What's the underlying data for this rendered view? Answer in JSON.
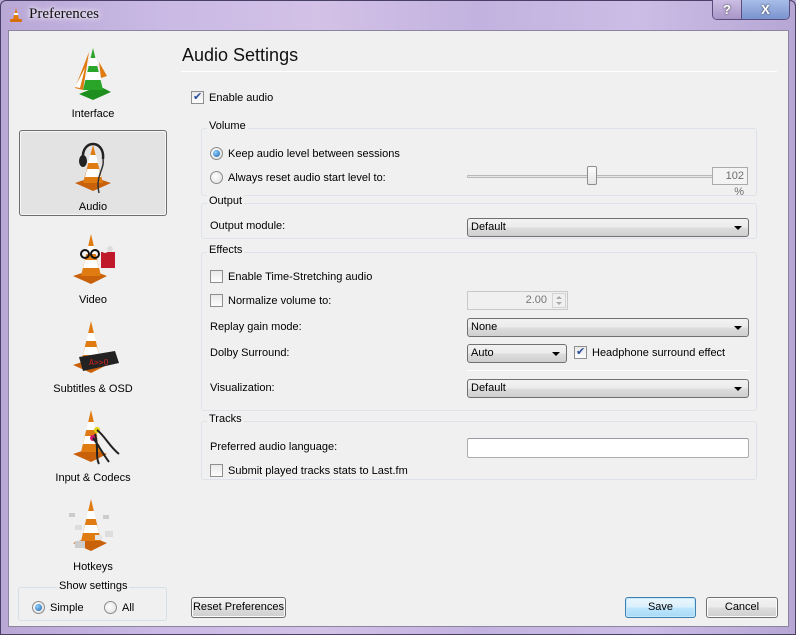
{
  "window": {
    "title": "Preferences",
    "help_button": "?",
    "close_button": "X"
  },
  "sidebar": {
    "categories": [
      {
        "id": "interface",
        "label": "Interface",
        "icon": "cone-interface-icon",
        "selected": false
      },
      {
        "id": "audio",
        "label": "Audio",
        "icon": "cone-headphones-icon",
        "selected": true
      },
      {
        "id": "video",
        "label": "Video",
        "icon": "cone-glasses-popcorn-icon",
        "selected": false
      },
      {
        "id": "subtitles",
        "label": "Subtitles & OSD",
        "icon": "cone-led-display-icon",
        "selected": false
      },
      {
        "id": "input",
        "label": "Input & Codecs",
        "icon": "cone-cables-icon",
        "selected": false
      },
      {
        "id": "hotkeys",
        "label": "Hotkeys",
        "icon": "cone-keys-icon",
        "selected": false
      }
    ],
    "show_settings": {
      "legend": "Show settings",
      "options": [
        {
          "label": "Simple",
          "checked": true
        },
        {
          "label": "All",
          "checked": false
        }
      ]
    }
  },
  "main": {
    "title": "Audio Settings",
    "enable_audio": {
      "label": "Enable audio",
      "checked": true
    },
    "volume": {
      "legend": "Volume",
      "keep_level": {
        "label": "Keep audio level between sessions",
        "checked": true
      },
      "always_reset": {
        "label": "Always reset audio start level to:",
        "checked": false
      },
      "level_value": "102 %",
      "level_percent": 102,
      "level_max_percent": 200
    },
    "output": {
      "legend": "Output",
      "module_label": "Output module:",
      "module_value": "Default"
    },
    "effects": {
      "legend": "Effects",
      "time_stretching": {
        "label": "Enable Time-Stretching audio",
        "checked": false
      },
      "normalize": {
        "label": "Normalize volume to:",
        "checked": false,
        "value": "2.00"
      },
      "replay_gain_label": "Replay gain mode:",
      "replay_gain_value": "None",
      "dolby_label": "Dolby Surround:",
      "dolby_value": "Auto",
      "headphone_surround": {
        "label": "Headphone surround effect",
        "checked": true
      },
      "visualization_label": "Visualization:",
      "visualization_value": "Default"
    },
    "tracks": {
      "legend": "Tracks",
      "preferred_language_label": "Preferred audio language:",
      "preferred_language_value": "",
      "lastfm": {
        "label": "Submit played tracks stats to Last.fm",
        "checked": false
      }
    }
  },
  "footer": {
    "reset_label": "Reset Preferences",
    "save_label": "Save",
    "cancel_label": "Cancel"
  },
  "colors": {
    "cone_orange": "#e07b12",
    "selected_bg": "#e3e3e3",
    "default_button_border": "#3c7fb1"
  }
}
